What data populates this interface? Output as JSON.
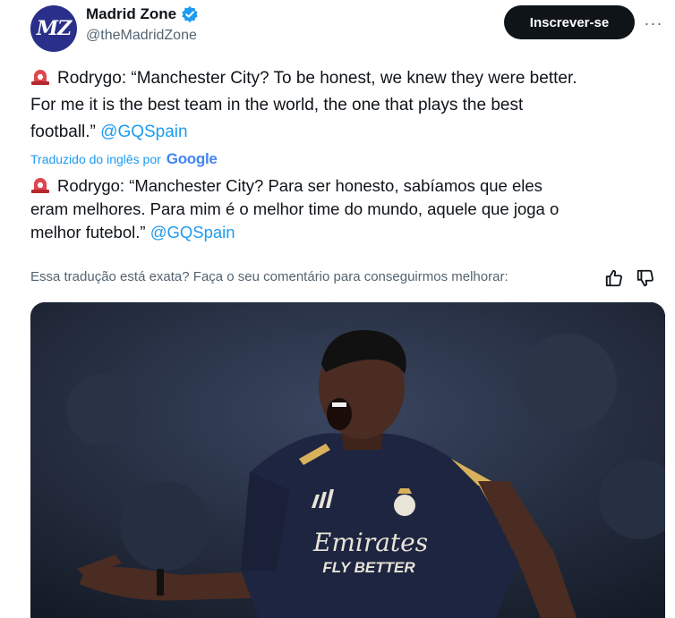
{
  "account": {
    "avatar_text": "MZ",
    "display_name": "Madrid Zone",
    "handle": "@theMadridZone"
  },
  "header": {
    "subscribe_label": "Inscrever-se",
    "more_label": "···"
  },
  "tweet": {
    "original_line1": "Rodrygo: “Manchester City? To be honest, we knew they were better.",
    "original_line2": "For me it is the best team in the world, the one that plays the best",
    "original_line3": "football.” ",
    "original_mention": "@GQSpain",
    "translated_by": "Traduzido do inglês por",
    "translator_brand": "Google",
    "translation_line1": "Rodrygo: “Manchester City? Para ser honesto, sabíamos que eles",
    "translation_line2": "eram melhores. Para mim é o melhor time do mundo, aquele que joga o",
    "translation_line3": "melhor futebol.” ",
    "translation_mention": "@GQSpain",
    "feedback_prompt": "Essa tradução está exata? Faça o seu comentário para conseguirmos melhorar:"
  },
  "media": {
    "shirt_sponsor_line1": "Emirates",
    "shirt_sponsor_line2": "FLY BETTER"
  },
  "colors": {
    "link": "#1d9bf0",
    "text": "#0f1419",
    "muted": "#536471",
    "button_bg": "#0f1419"
  },
  "icons": [
    "siren-icon",
    "verified-badge-icon",
    "thumbs-up-icon",
    "thumbs-down-icon",
    "more-icon"
  ]
}
